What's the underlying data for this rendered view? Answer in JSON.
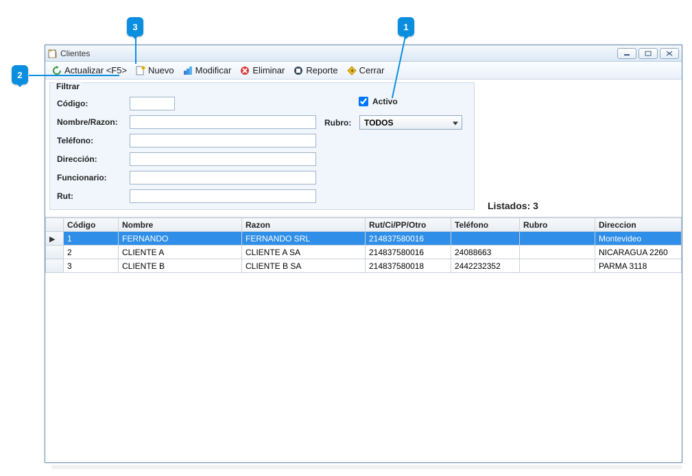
{
  "annotations": {
    "a1": "1",
    "a2": "2",
    "a3": "3"
  },
  "window": {
    "title": "Clientes"
  },
  "toolbar": {
    "refresh": "Actualizar <F5>",
    "new": "Nuevo",
    "edit": "Modificar",
    "delete": "Eliminar",
    "report": "Reporte",
    "close": "Cerrar"
  },
  "filter": {
    "legend": "Filtrar",
    "codigo_label": "Código:",
    "codigo_value": "",
    "nombre_label": "Nombre/Razon:",
    "nombre_value": "",
    "telefono_label": "Teléfono:",
    "telefono_value": "",
    "direccion_label": "Dirección:",
    "direccion_value": "",
    "funcionario_label": "Funcionario:",
    "funcionario_value": "",
    "rut_label": "Rut:",
    "rut_value": "",
    "activo_label": "Activo",
    "activo_checked": true,
    "rubro_label": "Rubro:",
    "rubro_value": "TODOS"
  },
  "listados_label": "Listados: 3",
  "grid": {
    "headers": {
      "codigo": "Código",
      "nombre": "Nombre",
      "razon": "Razon",
      "rut": "Rut/Ci/PP/Otro",
      "telefono": "Teléfono",
      "rubro": "Rubro",
      "direccion": "Direccion"
    },
    "rows": [
      {
        "codigo": "1",
        "nombre": "FERNANDO",
        "razon": "FERNANDO SRL",
        "rut": "214837580016",
        "telefono": "",
        "rubro": "",
        "direccion": "Montevideo"
      },
      {
        "codigo": "2",
        "nombre": "CLIENTE A",
        "razon": "CLIENTE A SA",
        "rut": "214837580016",
        "telefono": "24088663",
        "rubro": "",
        "direccion": "NICARAGUA 2260"
      },
      {
        "codigo": "3",
        "nombre": "CLIENTE B",
        "razon": "CLIENTE B SA",
        "rut": "214837580018",
        "telefono": "2442232352",
        "rubro": "",
        "direccion": "PARMA 3118"
      }
    ],
    "selected_index": 0,
    "row_marker": "▶"
  }
}
